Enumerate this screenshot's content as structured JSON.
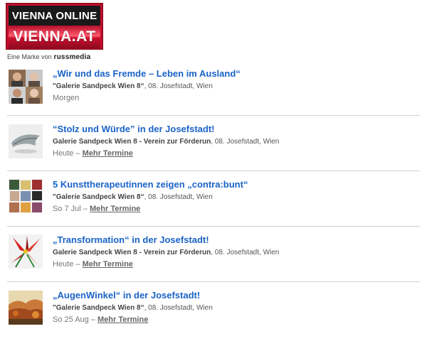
{
  "logo": {
    "top_text": "VIENNA ONLINE",
    "bottom_text": "VIENNA.AT",
    "tagline": "Eine Marke von",
    "tagline_brand": "russmedia"
  },
  "colors": {
    "title_link": "#1a63c8",
    "logo_red": "#c8102e",
    "logo_black": "#1a1a1a"
  },
  "events": [
    {
      "title": "„Wir und das Fremde – Leben im Ausland“",
      "venue_name": "\"Galerie Sandpeck Wien 8“",
      "venue_location": ", 08. Josefstadt, Wien",
      "date": "Morgen",
      "more_link": ""
    },
    {
      "title": "“Stolz und Würde” in der Josefstadt!",
      "venue_name": "Galerie Sandpeck Wien 8 - Verein zur Förderun",
      "venue_location": ", 08. Josefstadt, Wien",
      "date": "Heute – ",
      "more_link": "Mehr Termine"
    },
    {
      "title": "5 Kunsttherapeutinnen zeigen „contra:bunt“",
      "venue_name": "\"Galerie Sandpeck Wien 8“",
      "venue_location": ", 08. Josefstadt, Wien",
      "date": "So 7 Jul – ",
      "more_link": "Mehr Termine"
    },
    {
      "title": "„Transformation“ in der Josefstadt!",
      "venue_name": "Galerie Sandpeck Wien 8 - Verein zur Förderun",
      "venue_location": ", 08. Josefstadt, Wien",
      "date": "Heute – ",
      "more_link": "Mehr Termine"
    },
    {
      "title": "„AugenWinkel“ in der Josefstadt!",
      "venue_name": "\"Galerie Sandpeck Wien 8“",
      "venue_location": ", 08. Josefstadt, Wien",
      "date": "So 25 Aug – ",
      "more_link": "Mehr Termine"
    }
  ]
}
